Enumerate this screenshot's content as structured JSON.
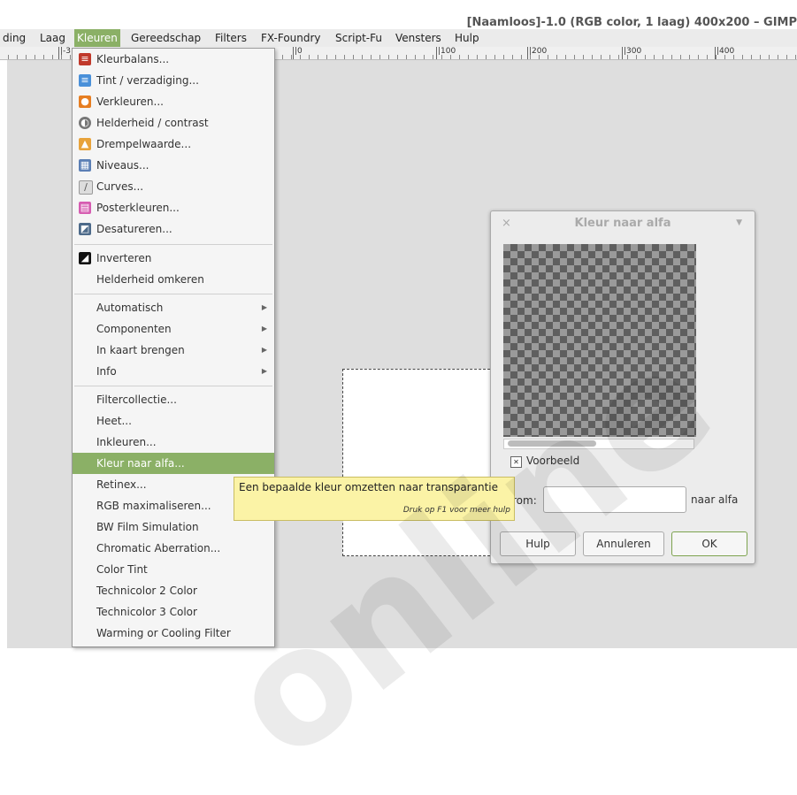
{
  "window": {
    "title": "[Naamloos]-1.0 (RGB color, 1 laag) 400x200 – GIMP"
  },
  "menubar": {
    "items": [
      "ding",
      "Laag",
      "Kleuren",
      "Gereedschap",
      "Filters",
      "FX-Foundry",
      "Script-Fu",
      "Vensters",
      "Hulp"
    ]
  },
  "ruler": {
    "ticks": [
      "|-3",
      "|0",
      "|100",
      "|200",
      "|300",
      "|400"
    ]
  },
  "menu": {
    "items": [
      {
        "label": "Kleurbalans..."
      },
      {
        "label": "Tint / verzadiging..."
      },
      {
        "label": "Verkleuren..."
      },
      {
        "label": "Helderheid / contrast"
      },
      {
        "label": "Drempelwaarde..."
      },
      {
        "label": "Niveaus..."
      },
      {
        "label": "Curves..."
      },
      {
        "label": "Posterkleuren..."
      },
      {
        "label": "Desatureren..."
      },
      {
        "label": "Inverteren"
      },
      {
        "label": "Helderheid omkeren"
      },
      {
        "label": "Automatisch"
      },
      {
        "label": "Componenten"
      },
      {
        "label": "In kaart brengen"
      },
      {
        "label": "Info"
      },
      {
        "label": "Filtercollectie..."
      },
      {
        "label": "Heet..."
      },
      {
        "label": "Inkleuren..."
      },
      {
        "label": "Kleur naar alfa..."
      },
      {
        "label": "Retinex..."
      },
      {
        "label": "RGB maximaliseren..."
      },
      {
        "label": "BW Film Simulation"
      },
      {
        "label": "Chromatic Aberration..."
      },
      {
        "label": "Color Tint"
      },
      {
        "label": "Technicolor 2 Color"
      },
      {
        "label": "Technicolor 3 Color"
      },
      {
        "label": "Warming or Cooling Filter"
      }
    ]
  },
  "tooltip": {
    "text": "Een bepaalde kleur omzetten naar transparantie",
    "hint": "Druk op F1 voor meer hulp"
  },
  "dialog": {
    "close": "×",
    "title": "Kleur naar alfa",
    "menu_arrow": "▼",
    "preview_checkbox": "Voorbeeld",
    "from_label": "rom:",
    "to_label": "naar alfa",
    "buttons": {
      "help": "Hulp",
      "cancel": "Annuleren",
      "ok": "OK"
    }
  },
  "watermark": "online",
  "colors": {
    "accent": "#8bb066",
    "tooltip": "#fbf3a6"
  }
}
